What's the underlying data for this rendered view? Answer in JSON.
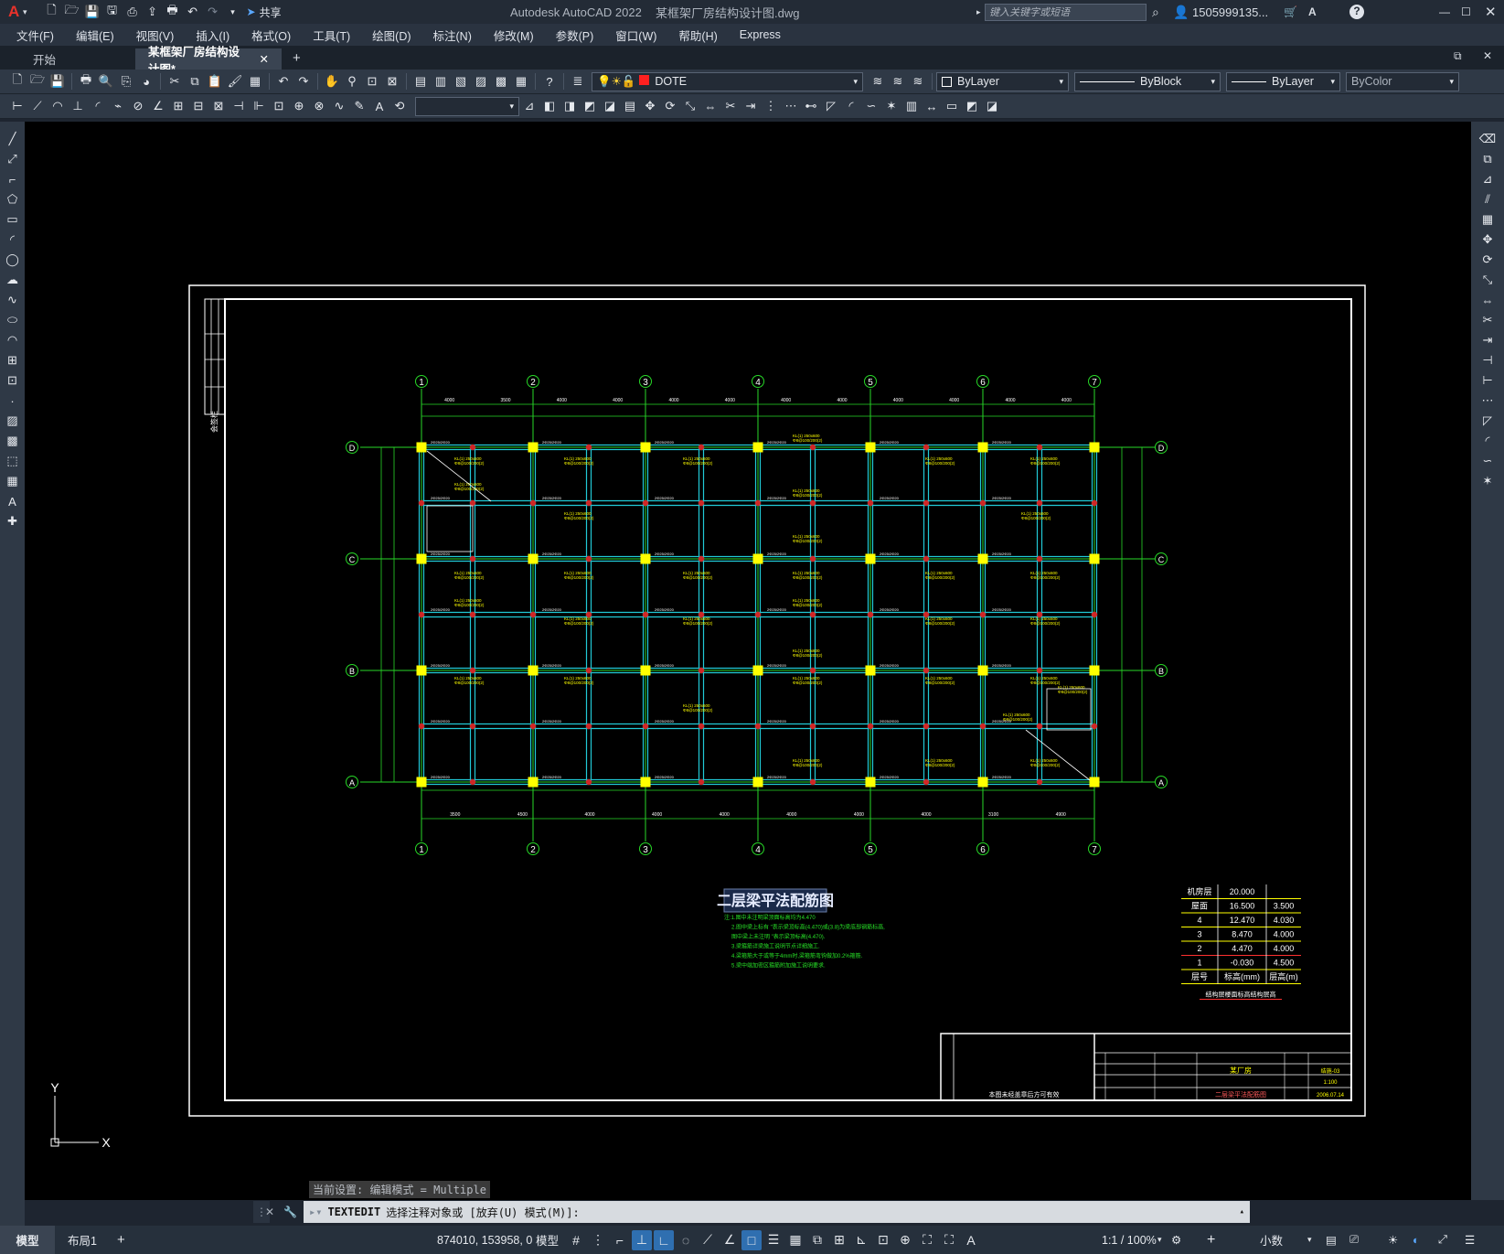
{
  "titlebar": {
    "app_logo": "A",
    "share_label": "共享",
    "app_title": "Autodesk AutoCAD 2022",
    "file_title": "某框架厂房结构设计图.dwg",
    "search_placeholder": "键入关键字或短语",
    "user": "1505999135..."
  },
  "menu": [
    "文件(F)",
    "编辑(E)",
    "视图(V)",
    "插入(I)",
    "格式(O)",
    "工具(T)",
    "绘图(D)",
    "标注(N)",
    "修改(M)",
    "参数(P)",
    "窗口(W)",
    "帮助(H)",
    "Express"
  ],
  "tabs": [
    {
      "label": "开始",
      "active": false
    },
    {
      "label": "某框架厂房结构设计图*",
      "active": true
    }
  ],
  "properties": {
    "layer": "DOTE",
    "color": "ByLayer",
    "linetype": "ByBlock",
    "lineweight": "ByLayer",
    "plotstyle": "ByColor"
  },
  "drawing": {
    "title": "二层梁平法配筋图",
    "notes": [
      "注:1.图中未注明梁顶面标高均为4.470",
      "2.图中梁上标有 \"表示梁顶标高(4.470)或(3.8)为梁底部钢筋标高,",
      "图中梁上未注明 \"表示梁顶标高(4.470).",
      "3.梁箍筋详梁施工说明节点详细施工.",
      "4.梁箍筋大于或等于4mm时,梁箍筋弯钩做加0.2%箍筋.",
      "5.梁中端加密区箍筋附加施工说明要求."
    ],
    "axes_top": [
      "1",
      "2",
      "3",
      "4",
      "5",
      "6",
      "7"
    ],
    "axes_side": [
      "D",
      "C",
      "B",
      "A"
    ],
    "dims_top": [
      "4000",
      "3500",
      "4000",
      "4000",
      "4000",
      "4000",
      "4000",
      "4000",
      "4000",
      "4000",
      "4000",
      "4000"
    ],
    "dims_bottom": [
      "3500",
      "4500",
      "4000",
      "4000",
      "4000",
      "4000",
      "4000",
      "4000",
      "3100",
      "4900"
    ],
    "left_title_block": "会签栏",
    "level_table": {
      "rows": [
        [
          "机房层",
          "20.000",
          ""
        ],
        [
          "屋面",
          "16.500",
          "3.500"
        ],
        [
          "4",
          "12.470",
          "4.030"
        ],
        [
          "3",
          "8.470",
          "4.000"
        ],
        [
          "2",
          "4.470",
          "4.000"
        ],
        [
          "1",
          "-0.030",
          "4.500"
        ],
        [
          "层号",
          "标高(mm)",
          "层高(m)"
        ]
      ],
      "caption": "结构层楼面标高结构层高"
    },
    "title_block": {
      "project": "某厂房",
      "drawing_name": "二层梁平法配筋图",
      "scale": "1:100",
      "date": "2006.07.14",
      "drawing_no": "结施-03",
      "note": "本图未经盖章后方可有效"
    }
  },
  "ucs": {
    "x_label": "X",
    "y_label": "Y"
  },
  "command": {
    "history": "当前设置: 编辑模式 = Multiple",
    "prompt_cmd": "TEXTEDIT",
    "prompt_text": "选择注释对象或 [放弃(U) 模式(M)]:"
  },
  "layout_tabs": [
    "模型",
    "布局1"
  ],
  "status": {
    "coords": "874010, 153958, 0",
    "model": "模型",
    "scale": "1:1 / 100%",
    "units": "小数"
  }
}
